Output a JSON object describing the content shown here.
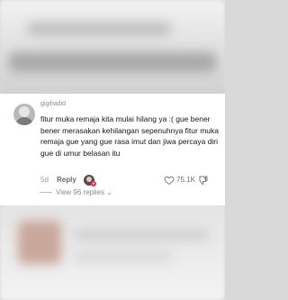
{
  "comment": {
    "username": "gigihadid",
    "text": "fitur muka remaja kita mulai hilang ya :( gue bener bener merasakan kehilangan sepenuhnya fitur muka remaja gue yang gue rasa imut dan jiwa percaya diri gue di umur belasan itu",
    "time": "5d",
    "reply_label": "Reply",
    "likes": "75.1K",
    "view_replies": "View 96 replies"
  },
  "icons": {
    "like": "heart-outline-icon",
    "dislike": "thumbs-down-icon",
    "expand": "chevron-down-icon"
  },
  "colors": {
    "badge": "#fe2c55",
    "username": "#8a8a8a",
    "text": "#161616"
  }
}
